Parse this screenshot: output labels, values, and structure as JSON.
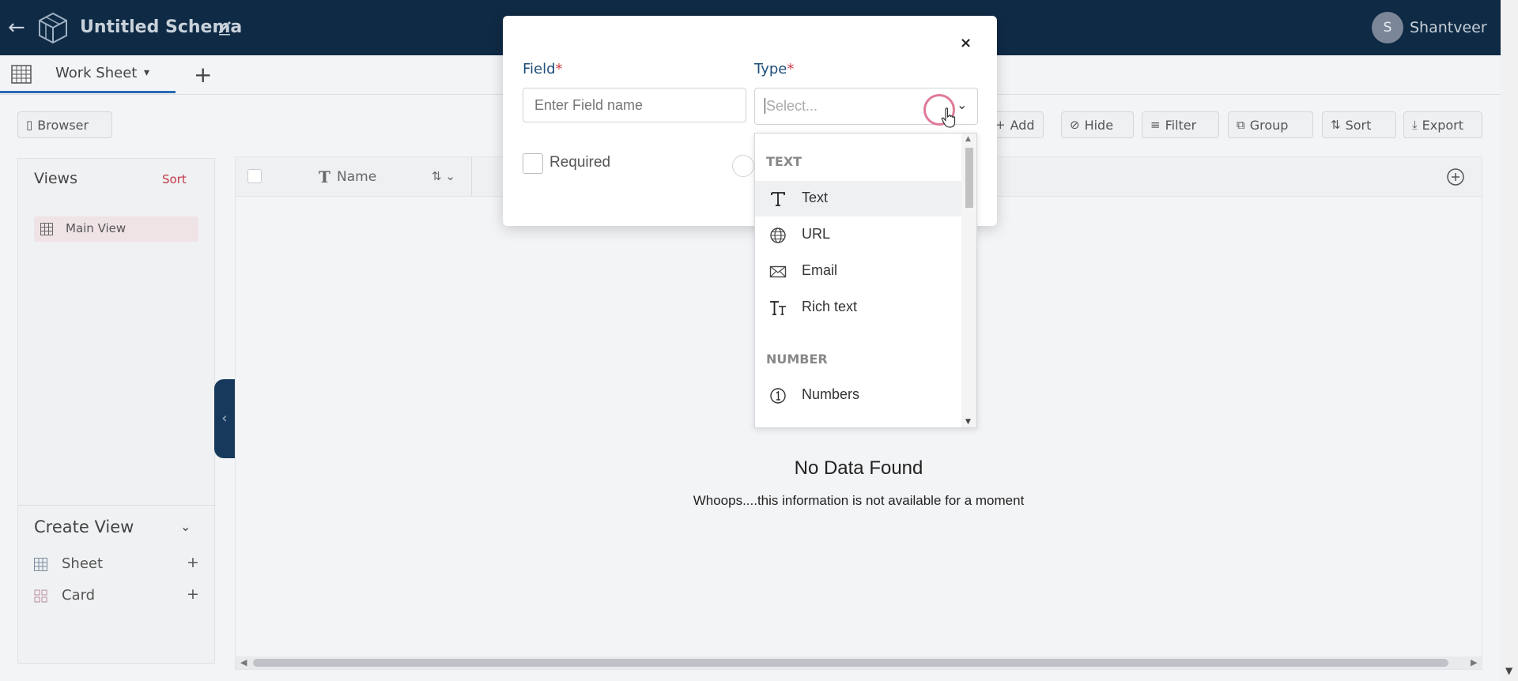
{
  "header": {
    "back_glyph": "←",
    "schema_title": "Untitled Schema",
    "user_initial": "S",
    "user_name": "Shantveer"
  },
  "tabs": {
    "active_label": "Work Sheet",
    "caret": "▾",
    "add": "+"
  },
  "toolbar": {
    "browser_label": "Browser",
    "add_label": "Add",
    "hide_label": "Hide",
    "filter_label": "Filter",
    "group_label": "Group",
    "sort_label": "Sort",
    "export_label": "Export"
  },
  "sidebar": {
    "views_title": "Views",
    "views_sort": "Sort",
    "views": [
      {
        "label": "Main View"
      }
    ],
    "create_view_title": "Create View",
    "create_items": [
      {
        "label": "Sheet",
        "add": "+"
      },
      {
        "label": "Card",
        "add": "+"
      }
    ]
  },
  "table": {
    "columns": [
      {
        "label": "Name"
      }
    ],
    "empty_title": "No Data Found",
    "empty_message": "Whoops....this information is not available for a moment"
  },
  "modal": {
    "close_glyph": "×",
    "field_label": "Field",
    "type_label": "Type",
    "required_mark": "*",
    "field_placeholder": "Enter Field name",
    "type_placeholder": "Select...",
    "required_label": "Required"
  },
  "dropdown": {
    "groups": [
      {
        "label": "TEXT",
        "options": [
          {
            "label": "Text",
            "icon": "text-type-icon",
            "selected": true
          },
          {
            "label": "URL",
            "icon": "globe-icon"
          },
          {
            "label": "Email",
            "icon": "envelope-icon"
          },
          {
            "label": "Rich text",
            "icon": "rich-text-icon"
          }
        ]
      },
      {
        "label": "NUMBER",
        "options": [
          {
            "label": "Numbers",
            "icon": "number-circle-icon"
          }
        ]
      }
    ]
  },
  "colors": {
    "header_bg": "#0f2a44",
    "accent_blue": "#1f4e79",
    "required_red": "#d23b4a",
    "sort_red": "#c0394b",
    "click_ring": "#e07a98"
  }
}
